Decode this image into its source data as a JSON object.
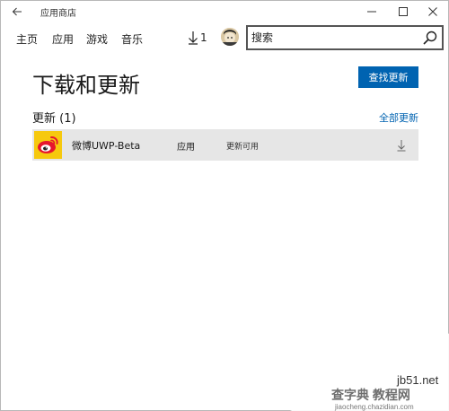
{
  "window": {
    "title": "应用商店",
    "controls": [
      "minimize-icon",
      "maximize-icon",
      "close-icon"
    ]
  },
  "nav": {
    "items": [
      {
        "label": "主页"
      },
      {
        "label": "应用"
      },
      {
        "label": "游戏"
      },
      {
        "label": "音乐"
      }
    ],
    "download_count": "1",
    "search": {
      "placeholder": "搜索",
      "value": ""
    }
  },
  "main": {
    "title": "下载和更新",
    "check_updates_label": "查找更新",
    "section_title": "更新 (1)",
    "update_all_label": "全部更新",
    "updates": [
      {
        "name": "微博UWP-Beta",
        "type": "应用",
        "status": "更新可用",
        "icon": "weibo-logo-icon"
      }
    ]
  },
  "watermark": {
    "site": "jb51.net",
    "brand": "查字典 教程网",
    "url": "jiaocheng.chazidian.com"
  },
  "colors": {
    "accent": "#0063b1",
    "row_bg": "#e6e6e6",
    "icon_bg": "#f6c90e",
    "weibo_red": "#e6162d"
  }
}
